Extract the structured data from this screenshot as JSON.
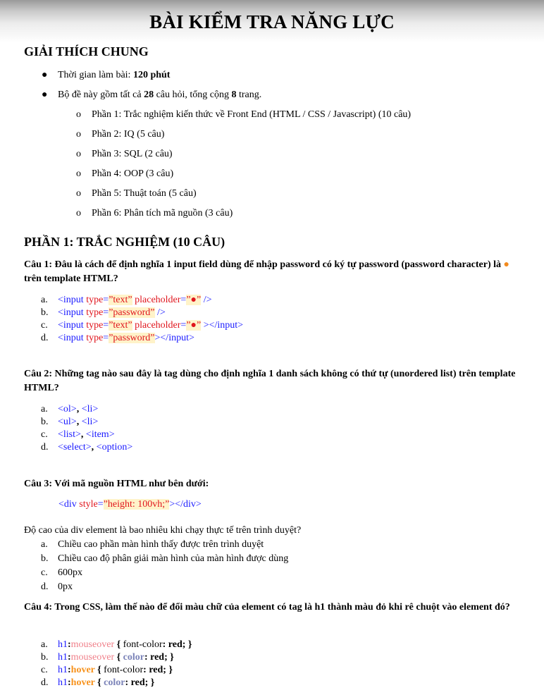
{
  "title": "BÀI KIỂM TRA NĂNG LỰC",
  "general": {
    "heading": "GIẢI THÍCH CHUNG",
    "time_label": "Thời gian làm bài: ",
    "time_value": "120 phút",
    "count_pre": "Bộ đề này gồm tất cả ",
    "count_questions": "28",
    "count_mid": " câu hỏi, tổng cộng ",
    "count_pages": "8",
    "count_post": " trang.",
    "sections": [
      "Phần 1: Trắc nghiệm kiến thức về Front End (HTML / CSS / Javascript) (10 câu)",
      "Phần 2: IQ (5 câu)",
      "Phần 3: SQL (2 câu)",
      "Phần 4: OOP (3 câu)",
      "Phần 5: Thuật toán (5 câu)",
      "Phần 6: Phân tích mã nguồn (3 câu)"
    ]
  },
  "part1": {
    "heading": "PHẦN 1: TRẮC NGHIỆM (10 CÂU)",
    "q1": {
      "text_pre": "Câu 1: Đâu là cách để định nghĩa 1 input field dùng để nhập password có ký tự password (password character) là ",
      "dot": "●",
      "text_post": " trên template HTML?",
      "options": [
        {
          "letter": "a.",
          "tag_open": "<input ",
          "attr1": "type",
          "eq": "=",
          "val1": "”text”",
          "attr2": " placeholder",
          "val2": "”●”",
          "tail": " />"
        },
        {
          "letter": "b.",
          "tag_open": "<input ",
          "attr1": "type",
          "eq": "=",
          "val1": "”password”",
          "tail": " />"
        },
        {
          "letter": "c.",
          "tag_open": "<input ",
          "attr1": "type",
          "eq": "=",
          "val1": "”text”",
          "attr2": " placeholder",
          "val2": "”●”",
          "tail": " ></input>"
        },
        {
          "letter": "d.",
          "tag_open": "<input ",
          "attr1": "type",
          "eq": "=",
          "val1": "”password”",
          "tail": "></input>"
        }
      ]
    },
    "q2": {
      "text": "Câu 2: Những tag nào sau đây là tag dùng cho định nghĩa 1 danh sách không có thứ tự (unordered list) trên template HTML?",
      "options": [
        {
          "letter": "a.",
          "t1": "<ol>",
          "sep": ", ",
          "t2": "<li>"
        },
        {
          "letter": "b.",
          "t1": "<ul>",
          "sep": ", ",
          "t2": "<li>"
        },
        {
          "letter": "c.",
          "t1": "<list>",
          "sep": ", ",
          "t2": "<item>"
        },
        {
          "letter": "d.",
          "t1": "<select>",
          "sep": ", ",
          "t2": "<option>"
        }
      ]
    },
    "q3": {
      "text": "Câu 3: Với mã nguồn HTML như bên dưới:",
      "code_open": "<div ",
      "code_attr": "style",
      "code_eq": "=",
      "code_val": "”height: 100vh;”",
      "code_close": "></div>",
      "question": "Độ cao của div element là bao nhiêu khi chạy thực tế trên trình duyệt?",
      "options": [
        {
          "letter": "a.",
          "text": "Chiều cao phần màn hình thấy được trên trình duyệt"
        },
        {
          "letter": "b.",
          "text": "Chiều cao độ phân giải màn hình của màn hình được dùng"
        },
        {
          "letter": "c.",
          "text": "600px"
        },
        {
          "letter": "d.",
          "text": "0px"
        }
      ]
    },
    "q4": {
      "text": "Câu 4: Trong CSS, làm thế nào để đổi màu chữ của element có tag là h1 thành màu đỏ khi rê chuột vào element đó?",
      "options": [
        {
          "letter": "a.",
          "sel": "h1",
          "colon": ":",
          "pseudo": "mouseover",
          "brace": " { ",
          "prop": "font-color",
          "rest": ": red; }"
        },
        {
          "letter": "b.",
          "sel": "h1",
          "colon": ":",
          "pseudo": "mouseover",
          "brace": " { ",
          "prop": "color",
          "rest": ": red; }"
        },
        {
          "letter": "c.",
          "sel": "h1",
          "colon": ":",
          "pseudo": "hover",
          "brace": " { ",
          "prop": "font-color",
          "rest": ": red; }"
        },
        {
          "letter": "d.",
          "sel": "h1",
          "colon": ":",
          "pseudo": "hover",
          "brace": " { ",
          "prop": "color",
          "rest": ": red; }"
        }
      ]
    }
  }
}
